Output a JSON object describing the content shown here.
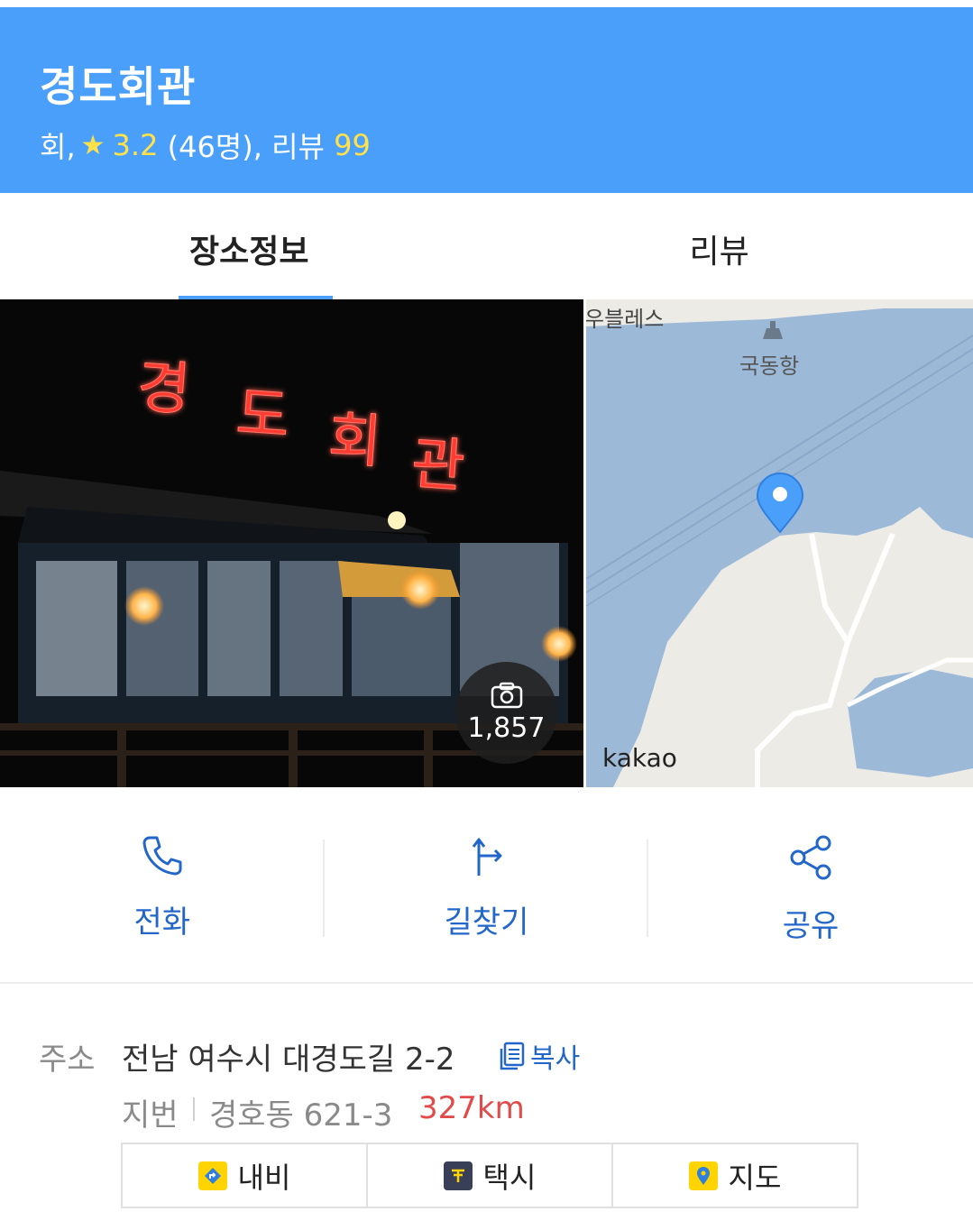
{
  "header": {
    "title": "경도회관",
    "category": "회,",
    "star": "★",
    "rating": "3.2",
    "rating_count": "(46명),",
    "review_label": "리뷰",
    "review_count": "99"
  },
  "tabs": [
    {
      "label": "장소정보",
      "active": true
    },
    {
      "label": "리뷰",
      "active": false
    }
  ],
  "photo": {
    "sign_chars": [
      "경",
      "도",
      "회",
      "관"
    ],
    "count": "1,857"
  },
  "map": {
    "label_top": "우블레스",
    "label_port": "국동항",
    "watermark": "kakao"
  },
  "actions": [
    {
      "label": "전화",
      "icon": "phone-icon"
    },
    {
      "label": "길찾기",
      "icon": "directions-icon"
    },
    {
      "label": "공유",
      "icon": "share-icon"
    }
  ],
  "info": {
    "address_key": "주소",
    "address_value": "전남 여수시 대경도길 2-2",
    "copy_label": "복사",
    "jibun_key": "지번",
    "jibun_value": "경호동 621-3",
    "distance": "327km"
  },
  "links": [
    {
      "label": "내비",
      "icon": "navi-icon"
    },
    {
      "label": "택시",
      "icon": "taxi-icon"
    },
    {
      "label": "지도",
      "icon": "map-pin-icon"
    }
  ],
  "colors": {
    "header_bg": "#4a9ffb",
    "accent_blue": "#2366c9",
    "highlight_yellow": "#ffe14a",
    "distance_red": "#e34a4a"
  }
}
